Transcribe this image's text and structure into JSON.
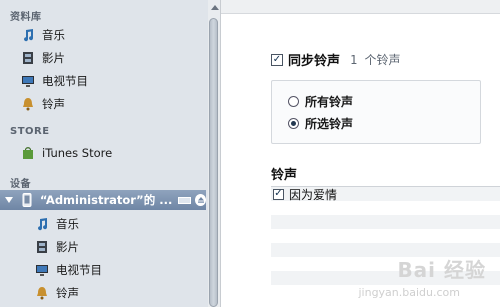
{
  "sidebar": {
    "library_header": "资料库",
    "library_items": [
      {
        "label": "音乐",
        "icon": "music-note-icon"
      },
      {
        "label": "影片",
        "icon": "film-icon"
      },
      {
        "label": "电视节目",
        "icon": "tv-icon"
      },
      {
        "label": "铃声",
        "icon": "bell-icon"
      }
    ],
    "store_header": "STORE",
    "store_items": [
      {
        "label": "iTunes Store",
        "icon": "store-bag-icon"
      }
    ],
    "devices_header": "设备",
    "device": {
      "label": "“Administrator”的 ...",
      "icon": "iphone-icon"
    },
    "device_items": [
      {
        "label": "音乐",
        "icon": "music-note-icon"
      },
      {
        "label": "影片",
        "icon": "film-icon"
      },
      {
        "label": "电视节目",
        "icon": "tv-icon"
      },
      {
        "label": "铃声",
        "icon": "bell-icon"
      }
    ]
  },
  "main": {
    "sync_label": "同步铃声",
    "sync_count": "1 个铃声",
    "sync_checked": true,
    "options": [
      {
        "label": "所有铃声",
        "selected": false
      },
      {
        "label": "所选铃声",
        "selected": true
      }
    ],
    "list_title": "铃声",
    "ringtones": [
      {
        "label": "因为爱情",
        "checked": true
      }
    ]
  },
  "watermark": {
    "main": "Bai 经验",
    "sub": "jingyan.baidu.com"
  },
  "colors": {
    "sidebar_bg": "#dfe4ea",
    "selected_row": "#7b91ae"
  }
}
